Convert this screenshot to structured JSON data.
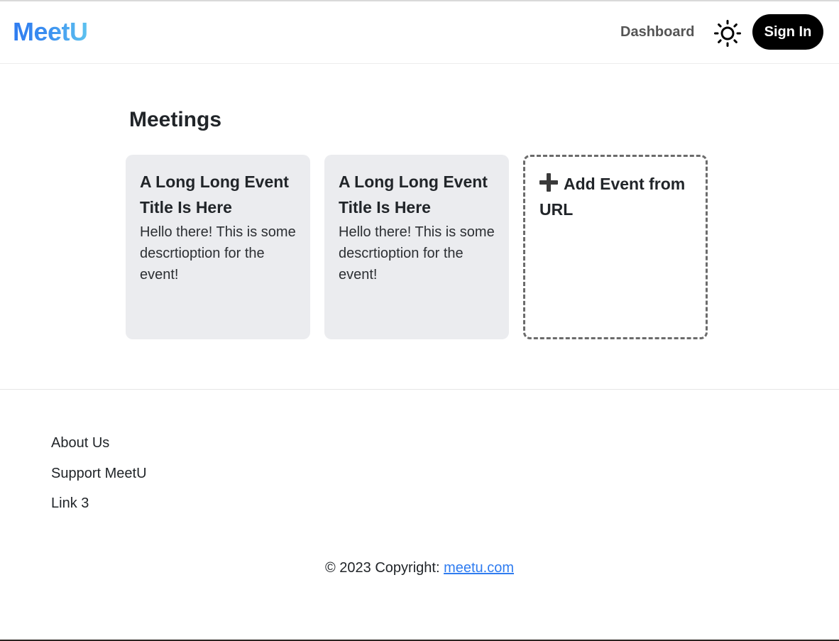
{
  "header": {
    "brand": "MeetU",
    "nav_dashboard": "Dashboard",
    "theme_icon": "sun-icon",
    "signin_label": "Sign In"
  },
  "main": {
    "title": "Meetings",
    "events": [
      {
        "title": "A Long Long Event Title Is Here",
        "description": "Hello there! This is some descrtioption for the event!"
      },
      {
        "title": "A Long Long Event Title Is Here",
        "description": "Hello there! This is some descrtioption for the event!"
      }
    ],
    "add_event": {
      "icon": "plus-icon",
      "label": "Add Event from URL"
    }
  },
  "footer": {
    "links": [
      "About Us",
      "Support MeetU",
      "Link 3"
    ],
    "copyright_prefix": "© 2023 Copyright: ",
    "copyright_link": "meetu.com"
  },
  "colors": {
    "brand_gradient_start": "#2f7cf0",
    "brand_gradient_end": "#5ec3ef",
    "card_background": "#ebecef",
    "signin_background": "#000000",
    "link": "#2f7cf0"
  }
}
